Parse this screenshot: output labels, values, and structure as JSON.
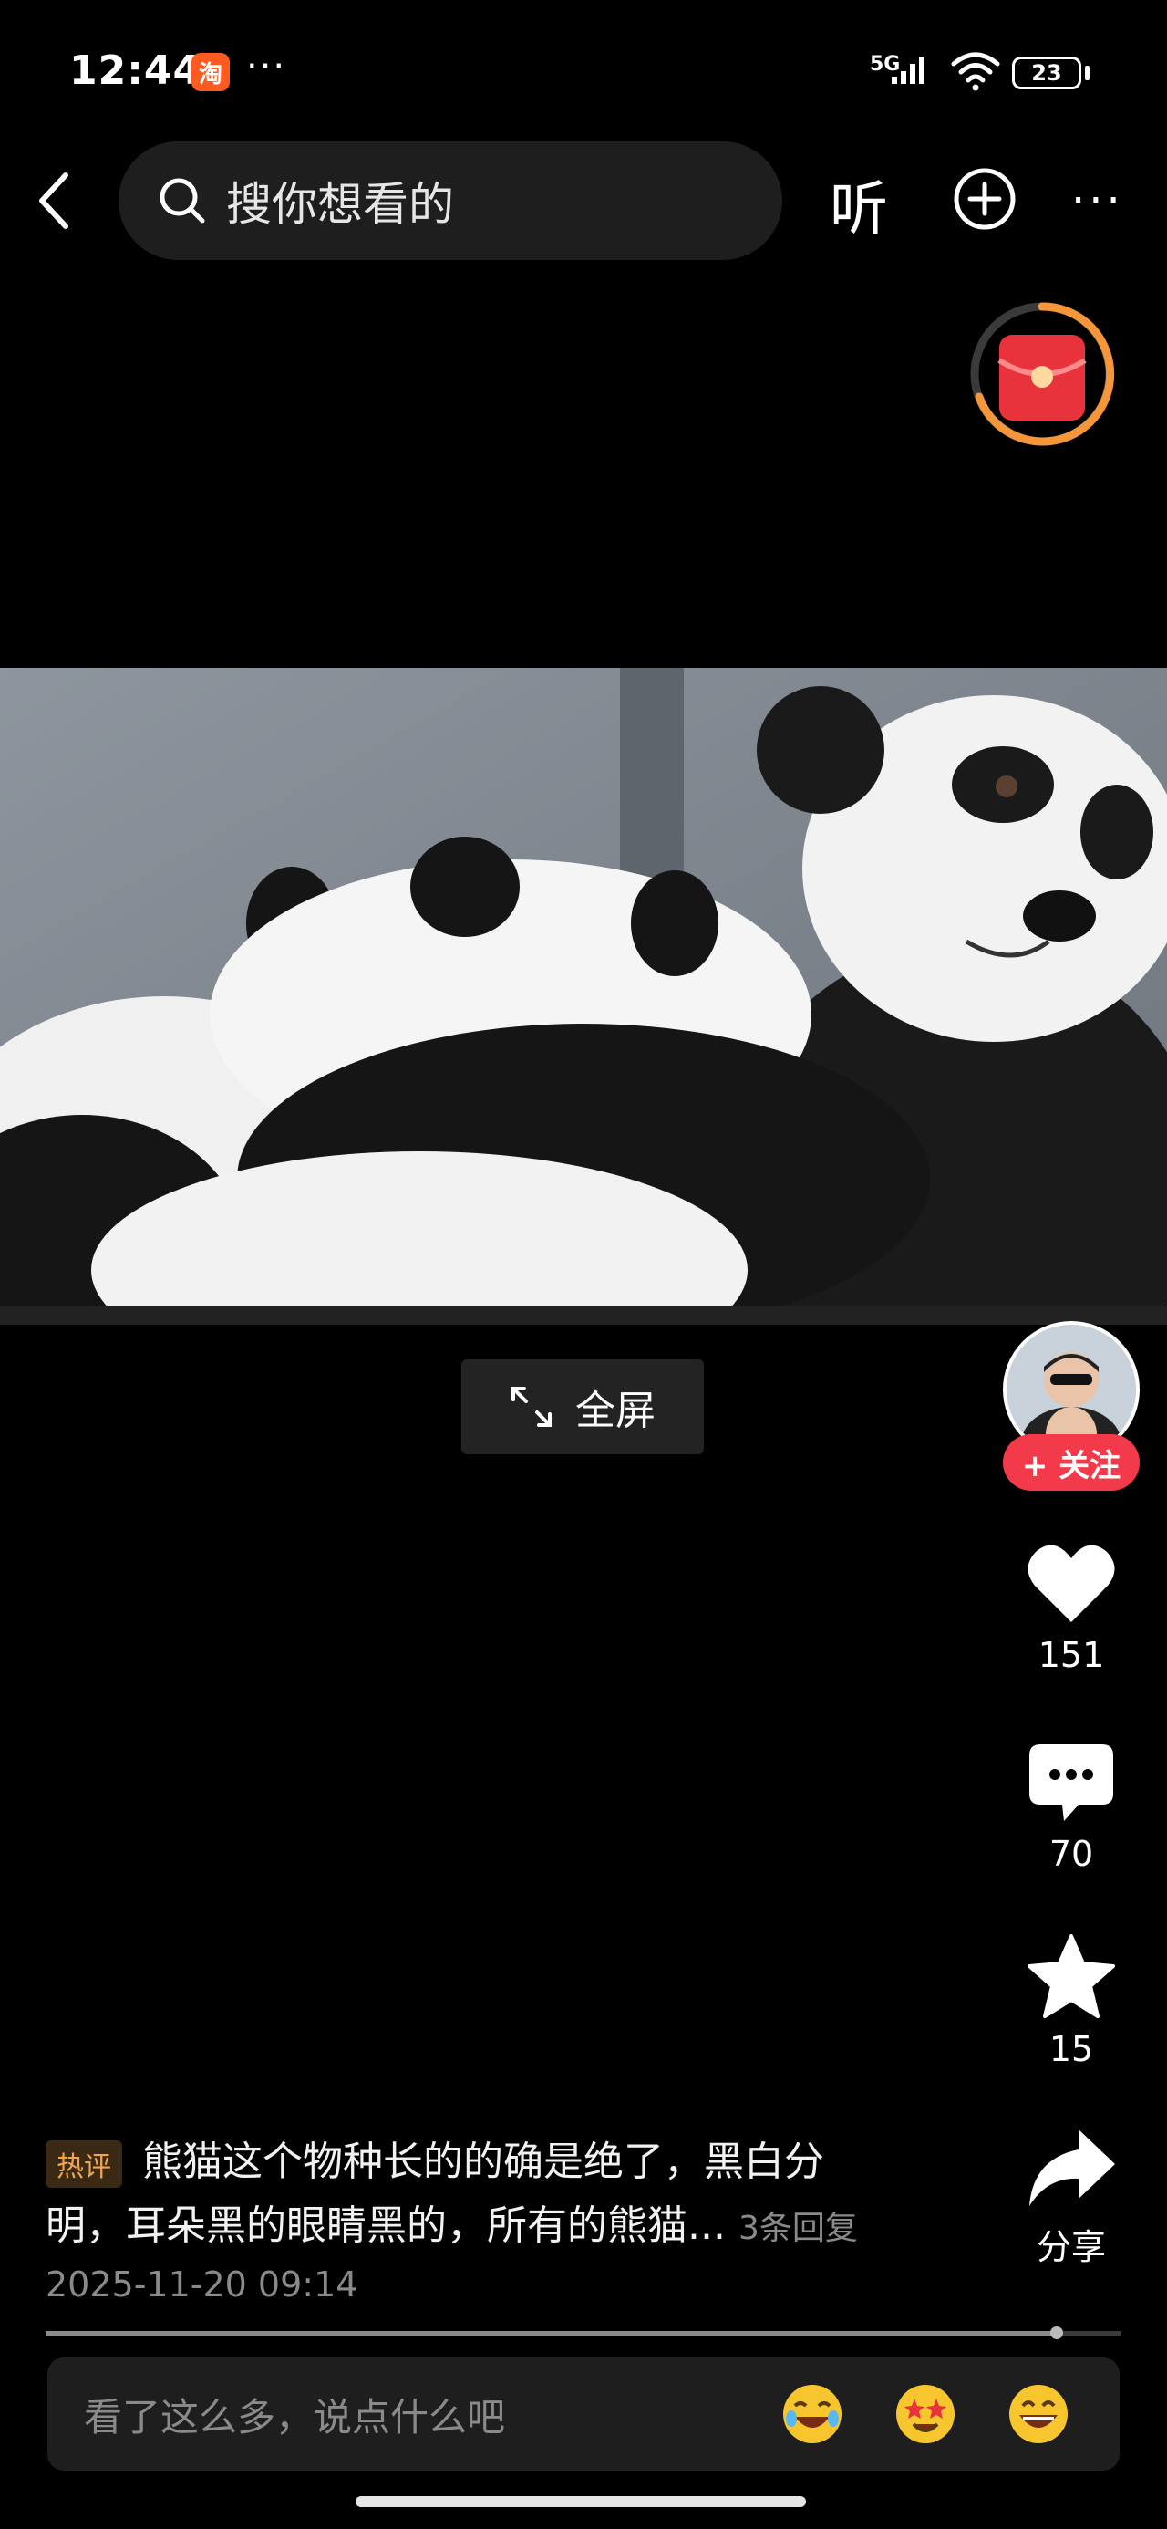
{
  "status_bar": {
    "time": "12:44",
    "app_badge": "淘",
    "more_dots": "···",
    "network": "5G",
    "battery": "23"
  },
  "top_nav": {
    "search_placeholder": "搜你想看的",
    "listen_label": "听",
    "more_label": "···"
  },
  "video": {
    "fullscreen_label": "全屏"
  },
  "right_rail": {
    "follow_label": "+ 关注",
    "likes": "151",
    "comments": "70",
    "favorites": "15",
    "share_label": "分享"
  },
  "comment": {
    "tag": "热评",
    "line1": "熊猫这个物种长的的确是绝了，黑白分",
    "line2": "明，耳朵黑的眼睛黑的，所有的熊猫...",
    "reply_count": "3条回复",
    "timestamp": "2025-11-20 09:14"
  },
  "playback": {
    "progress": 0.94
  },
  "comment_input": {
    "placeholder": "看了这么多，说点什么吧"
  },
  "colors": {
    "follow": "#f23a4a",
    "hot_tag": "#f3a54c",
    "redpacket_ring": "#f5963a"
  },
  "icons": [
    "back-icon",
    "search-icon",
    "add-circle-icon",
    "redpacket-icon",
    "fullscreen-icon",
    "heart-icon",
    "comment-icon",
    "star-icon",
    "share-icon",
    "laughing-emoji-icon",
    "star-eyes-emoji-icon",
    "grin-emoji-icon"
  ]
}
